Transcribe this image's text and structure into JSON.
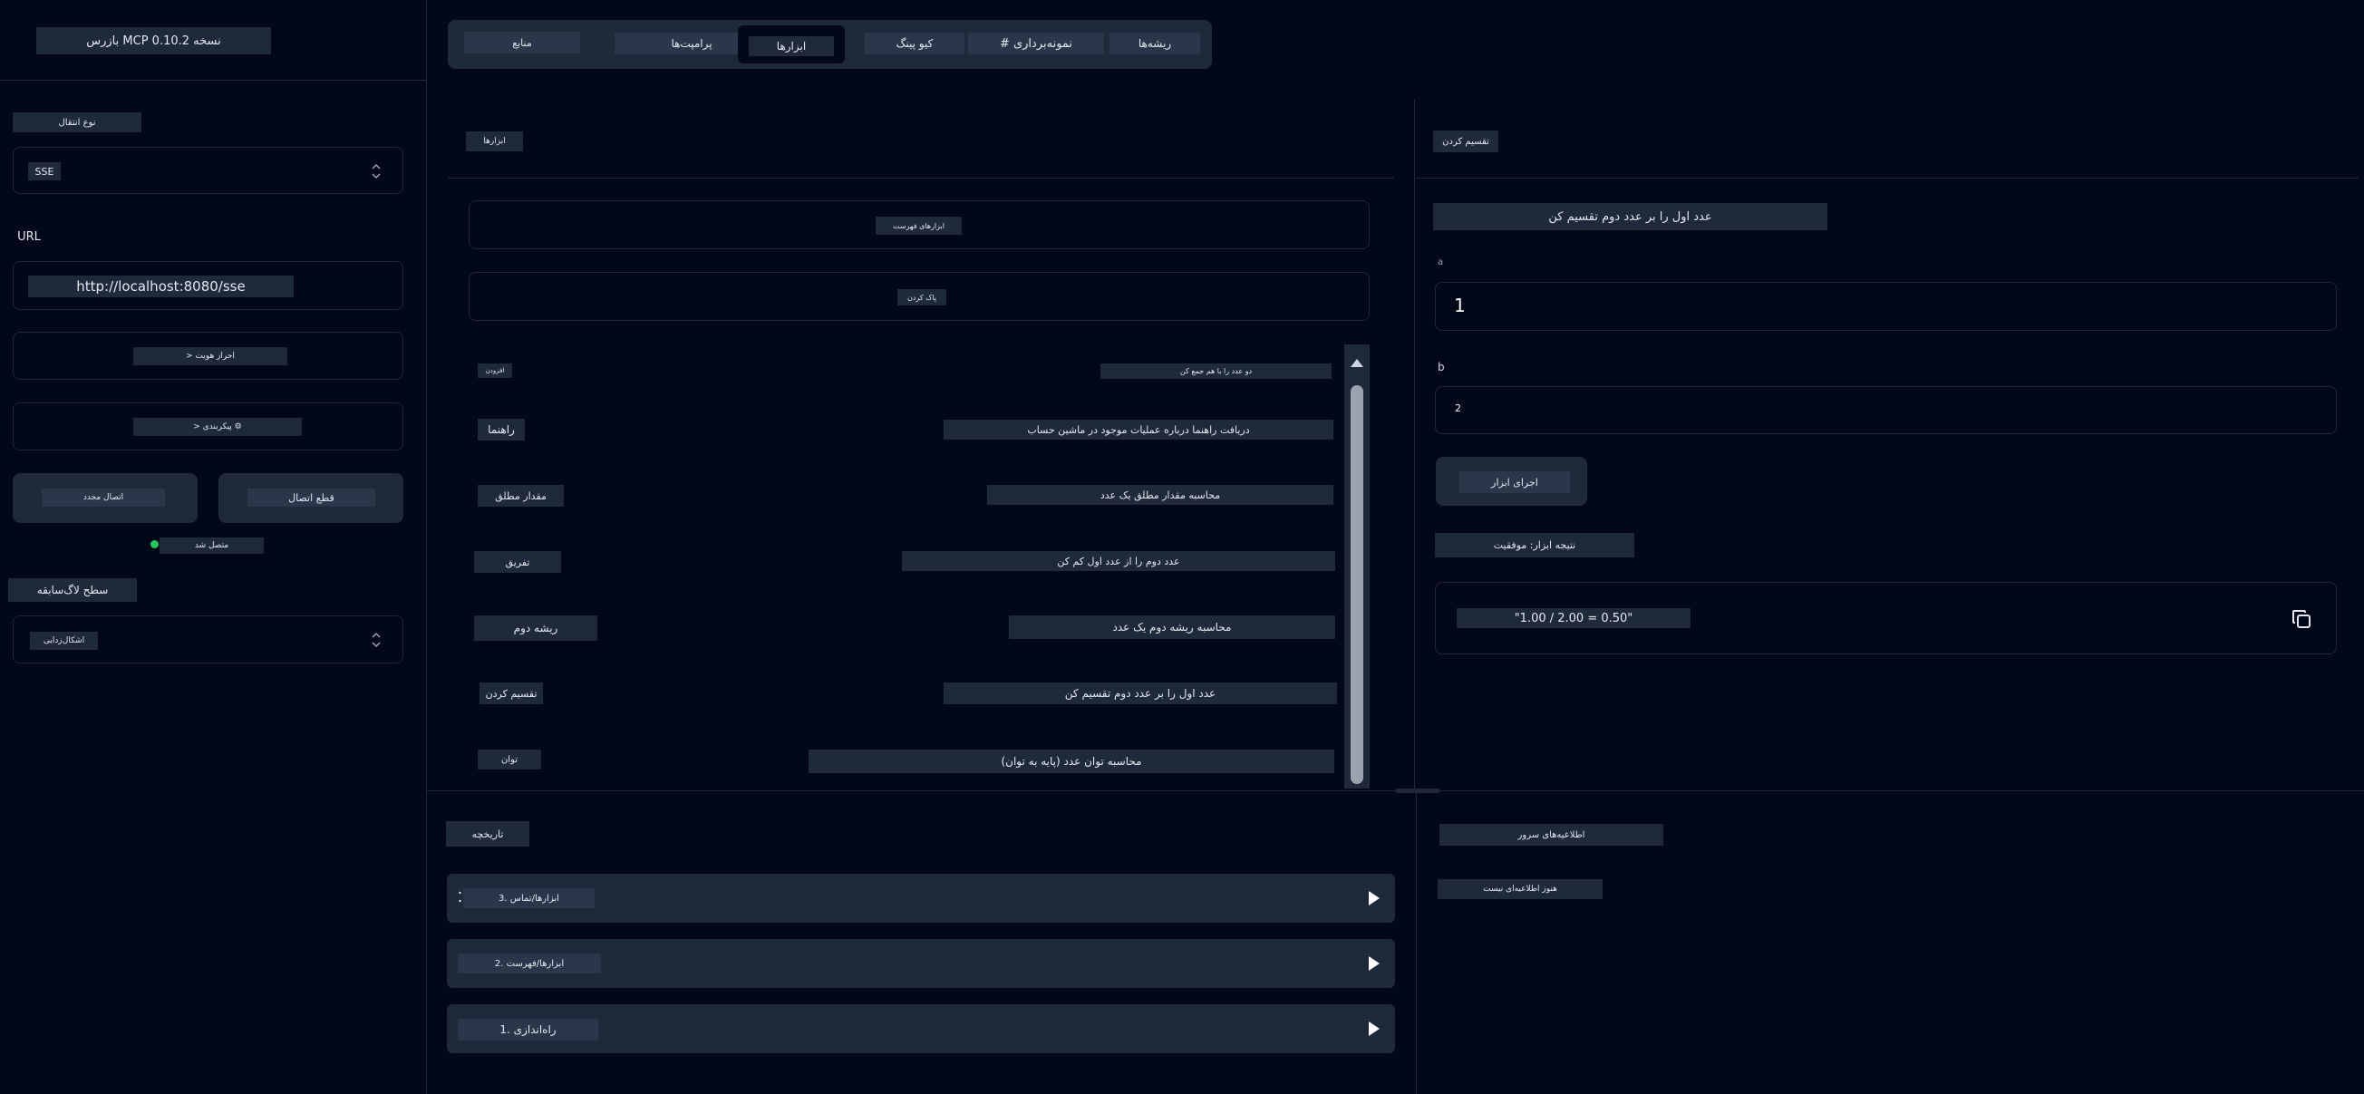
{
  "sidebar": {
    "version_title": "بازرس MCP نسخه 0.10.2",
    "transport_label": "نوع انتقال",
    "transport_value": "SSE",
    "url_label": "URL",
    "url_value": "http://localhost:8080/sse",
    "auth_button": "> احراز هویت",
    "config_button": "> پیکربندی ⚙",
    "reconnect_button": "اتصال مجدد",
    "disconnect_button": "قطع اتصال",
    "status_text": "متصل شد",
    "log_level_label": "سطح لاگ‌سابقه",
    "log_level_value": "اشکال‌زدایی",
    "status_color": "#22c55e"
  },
  "tabs": [
    "منابع",
    "پرامپت‌ها",
    "ابزارها",
    "کیو پینگ",
    "# نمونه‌برداری",
    "ریشه‌ها"
  ],
  "active_tab": 2,
  "tools_panel": {
    "title": "ابزارها",
    "list_button": "ابزارهای فهرست",
    "clear_button": "پاک کردن",
    "items": [
      {
        "name": "افزودن",
        "desc": "دو عدد را با هم جمع کن"
      },
      {
        "name": "راهنما",
        "desc": "دریافت راهنما درباره عملیات موجود در ماشین حساب"
      },
      {
        "name": "مقدار مطلق",
        "desc": "محاسبه مقدار مطلق یک عدد"
      },
      {
        "name": "تفریق",
        "desc": "عدد دوم را از عدد اول کم کن"
      },
      {
        "name": "ریشه دوم",
        "desc": "محاسبه ریشه دوم یک عدد"
      },
      {
        "name": "تقسیم کردن",
        "desc": "عدد اول را بر عدد دوم تقسیم کن"
      },
      {
        "name": "توان",
        "desc": "محاسبه توان عدد (پایه به توان)"
      }
    ]
  },
  "tool_detail": {
    "title": "تقسیم کردن",
    "description": "عدد اول را بر عدد دوم تقسیم کن",
    "param_a_label": "a",
    "param_a_value": "1",
    "param_b_label": "b",
    "param_b_value": "2",
    "run_button": "اجرای ابزار",
    "result_label": "نتیجه ابزار: موفقیت",
    "result_value": "\"1.00 / 2.00 = 0.50\""
  },
  "history": {
    "title": "تاریخچه",
    "items": [
      "3. ابزارها/تماس",
      "2. ابزارها/فهرست",
      "1. راه‌اندازی"
    ]
  },
  "notifications": {
    "title": "اطلاعیه‌های سرور",
    "empty": "هنوز اطلاعیه‌ای نیست"
  }
}
